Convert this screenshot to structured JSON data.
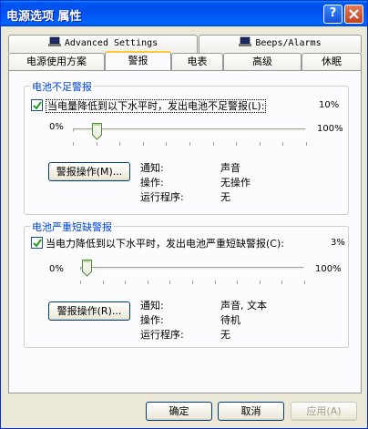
{
  "window": {
    "title": "电源选项 属性",
    "help_glyph": "?"
  },
  "tabs_back": [
    {
      "label": "Advanced Settings"
    },
    {
      "label": "Beeps/Alarms"
    }
  ],
  "tabs_front": [
    {
      "label": "电源使用方案"
    },
    {
      "label": "警报"
    },
    {
      "label": "电表"
    },
    {
      "label": "高级"
    },
    {
      "label": "休眠"
    }
  ],
  "low": {
    "group_title": "电池不足警报",
    "checkbox_label": "当电量降低到以下水平时，发出电池不足警报(L):",
    "checked": true,
    "value_pct": "10%",
    "slider_min": "0%",
    "slider_max": "100%",
    "level": 0.1,
    "action_button": "警报操作(M)...",
    "notify_label": "通知:",
    "notify_value": "声音",
    "action_label": "操作:",
    "action_value": "无操作",
    "program_label": "运行程序:",
    "program_value": "无"
  },
  "critical": {
    "group_title": "电池严重短缺警报",
    "checkbox_label": "当电力降低到以下水平时，发出电池严重短缺警报(C):",
    "checked": true,
    "value_pct": "3%",
    "slider_min": "0%",
    "slider_max": "100%",
    "level": 0.03,
    "action_button": "警报操作(R)...",
    "notify_label": "通知:",
    "notify_value": "声音, 文本",
    "action_label": "操作:",
    "action_value": "待机",
    "program_label": "运行程序:",
    "program_value": "无"
  },
  "footer": {
    "ok": "确定",
    "cancel": "取消",
    "apply": "应用(A)"
  },
  "colors": {
    "accent": "#0046d5",
    "titlebar": "#0054e3",
    "tab_highlight": "#ffc83c"
  }
}
